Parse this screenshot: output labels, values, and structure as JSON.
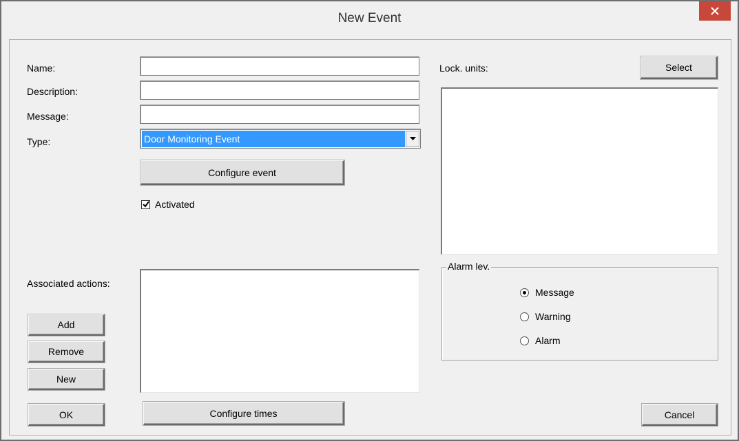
{
  "window": {
    "title": "New Event"
  },
  "form": {
    "name_label": "Name:",
    "name_value": "",
    "description_label": "Description:",
    "description_value": "",
    "message_label": "Message:",
    "message_value": "",
    "type_label": "Type:",
    "type_selected": "Door Monitoring Event",
    "configure_event_label": "Configure event",
    "activated_label": "Activated",
    "activated_checked": true
  },
  "actions": {
    "label": "Associated actions:",
    "add_label": "Add",
    "remove_label": "Remove",
    "new_label": "New"
  },
  "lock_units": {
    "label": "Lock. units:",
    "select_label": "Select"
  },
  "alarm": {
    "group_label": "Alarm lev.",
    "options": [
      {
        "label": "Message",
        "selected": true
      },
      {
        "label": "Warning",
        "selected": false
      },
      {
        "label": "Alarm",
        "selected": false
      }
    ]
  },
  "footer": {
    "ok_label": "OK",
    "configure_times_label": "Configure times",
    "cancel_label": "Cancel"
  },
  "icons": {
    "close": "close-icon",
    "dropdown": "chevron-down-icon",
    "check": "checkmark-icon"
  }
}
